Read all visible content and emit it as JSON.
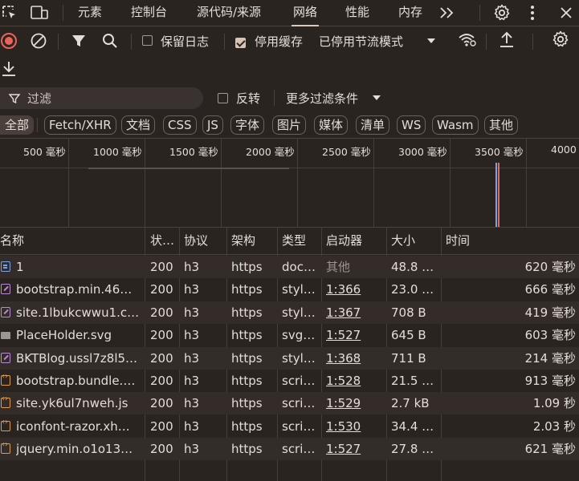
{
  "tabs": [
    {
      "label": "元素",
      "active": false
    },
    {
      "label": "控制台",
      "active": false
    },
    {
      "label": "源代码/来源",
      "active": false
    },
    {
      "label": "网络",
      "active": true
    },
    {
      "label": "性能",
      "active": false
    },
    {
      "label": "内存",
      "active": false
    }
  ],
  "tabbar": {
    "left_icons": [
      "inspect-element-icon",
      "device-toggle-icon"
    ],
    "more_tabs_icon": "double-chevron-icon",
    "settings_icon": "gear-icon",
    "menu_icon": "vertical-dots-icon"
  },
  "toolbar": {
    "preserve_log": {
      "label": "保留日志",
      "checked": false
    },
    "disable_cache": {
      "label": "停用缓存",
      "checked": true
    },
    "throttling": {
      "label": "已停用节流模式"
    }
  },
  "filter": {
    "placeholder": "过滤",
    "invert": {
      "label": "反转",
      "checked": false
    },
    "more_filters": "更多过滤条件"
  },
  "type_filters": [
    {
      "label": "全部",
      "active": true
    },
    {
      "label": "Fetch/XHR",
      "active": false
    },
    {
      "label": "文档",
      "active": false
    },
    {
      "label": "CSS",
      "active": false
    },
    {
      "label": "JS",
      "active": false
    },
    {
      "label": "字体",
      "active": false
    },
    {
      "label": "图片",
      "active": false
    },
    {
      "label": "媒体",
      "active": false
    },
    {
      "label": "清单",
      "active": false
    },
    {
      "label": "WS",
      "active": false
    },
    {
      "label": "Wasm",
      "active": false
    },
    {
      "label": "其他",
      "active": false
    }
  ],
  "overview": {
    "tick_labels": [
      "500 毫秒",
      "1000 毫秒",
      "1500 毫秒",
      "2000 毫秒",
      "2500 毫秒",
      "3000 毫秒",
      "3500 毫秒",
      "4000"
    ],
    "colors": {
      "marker_blue": "#7aa2e8",
      "marker_red": "#e06c5c"
    }
  },
  "table": {
    "columns": [
      "名称",
      "状…",
      "协议",
      "架构",
      "类型",
      "启动器",
      "大小",
      "时间"
    ],
    "rows": [
      {
        "icon": "doc",
        "name": "1",
        "status": "200",
        "protocol": "h3",
        "scheme": "https",
        "type": "doc…",
        "initiator": "其他",
        "initiator_link": false,
        "size": "48.8 …",
        "time": "620 毫秒"
      },
      {
        "icon": "css",
        "name": "bootstrap.min.46…",
        "status": "200",
        "protocol": "h3",
        "scheme": "https",
        "type": "styl…",
        "initiator": "1:366",
        "initiator_link": true,
        "size": "23.0 …",
        "time": "666 毫秒"
      },
      {
        "icon": "css",
        "name": "site.1lbukcwwu1.c…",
        "status": "200",
        "protocol": "h3",
        "scheme": "https",
        "type": "styl…",
        "initiator": "1:367",
        "initiator_link": true,
        "size": "708 B",
        "time": "419 毫秒"
      },
      {
        "icon": "img",
        "name": "PlaceHolder.svg",
        "status": "200",
        "protocol": "h3",
        "scheme": "https",
        "type": "svg…",
        "initiator": "1:527",
        "initiator_link": true,
        "size": "645 B",
        "time": "603 毫秒"
      },
      {
        "icon": "css",
        "name": "BKTBlog.ussl7z8l5…",
        "status": "200",
        "protocol": "h3",
        "scheme": "https",
        "type": "styl…",
        "initiator": "1:368",
        "initiator_link": true,
        "size": "711 B",
        "time": "214 毫秒"
      },
      {
        "icon": "js",
        "name": "bootstrap.bundle.…",
        "status": "200",
        "protocol": "h3",
        "scheme": "https",
        "type": "scri…",
        "initiator": "1:528",
        "initiator_link": true,
        "size": "21.5 …",
        "time": "913 毫秒"
      },
      {
        "icon": "js",
        "name": "site.yk6ul7nweh.js",
        "status": "200",
        "protocol": "h3",
        "scheme": "https",
        "type": "scri…",
        "initiator": "1:529",
        "initiator_link": true,
        "size": "2.7 kB",
        "time": "1.09 秒"
      },
      {
        "icon": "js",
        "name": "iconfont-razor.xh…",
        "status": "200",
        "protocol": "h3",
        "scheme": "https",
        "type": "scri…",
        "initiator": "1:530",
        "initiator_link": true,
        "size": "34.4 …",
        "time": "2.03 秒"
      },
      {
        "icon": "js",
        "name": "jquery.min.o1o13…",
        "status": "200",
        "protocol": "h3",
        "scheme": "https",
        "type": "scri…",
        "initiator": "1:527",
        "initiator_link": true,
        "size": "27.8 …",
        "time": "621 毫秒"
      }
    ]
  }
}
